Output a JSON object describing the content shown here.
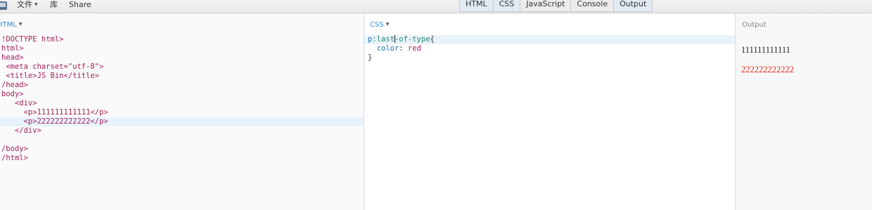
{
  "menu": {
    "file": "文件",
    "library": "库",
    "share": "Share"
  },
  "toggles": [
    "HTML",
    "CSS",
    "JavaScript",
    "Console",
    "Output"
  ],
  "html_panel": {
    "label": "HTML",
    "lines": [
      "!DOCTYPE html>",
      "html>",
      "head>",
      " <meta charset=\"utf-8\">",
      " <title>JS Bin</title>",
      "/head>",
      "body>",
      "   <div>",
      "     <p>111111111111</p>",
      "     <p>222222222222</p>",
      "   </div>",
      "",
      "/body>",
      "/html>"
    ]
  },
  "css_panel": {
    "label": "CSS",
    "selector": "p",
    "pseudo_a": ":last",
    "pseudo_b": "-of-type",
    "open_brace": "{",
    "property": "color",
    "value": "red",
    "close_brace": "}"
  },
  "output_panel": {
    "label": "Output",
    "p1": "111111111111",
    "p2": "222222222222",
    "p2_color": "#e0261b"
  },
  "colors": {
    "panel_label_accent": "#3b8fd6",
    "highlight_line": "#e8f2fb"
  }
}
